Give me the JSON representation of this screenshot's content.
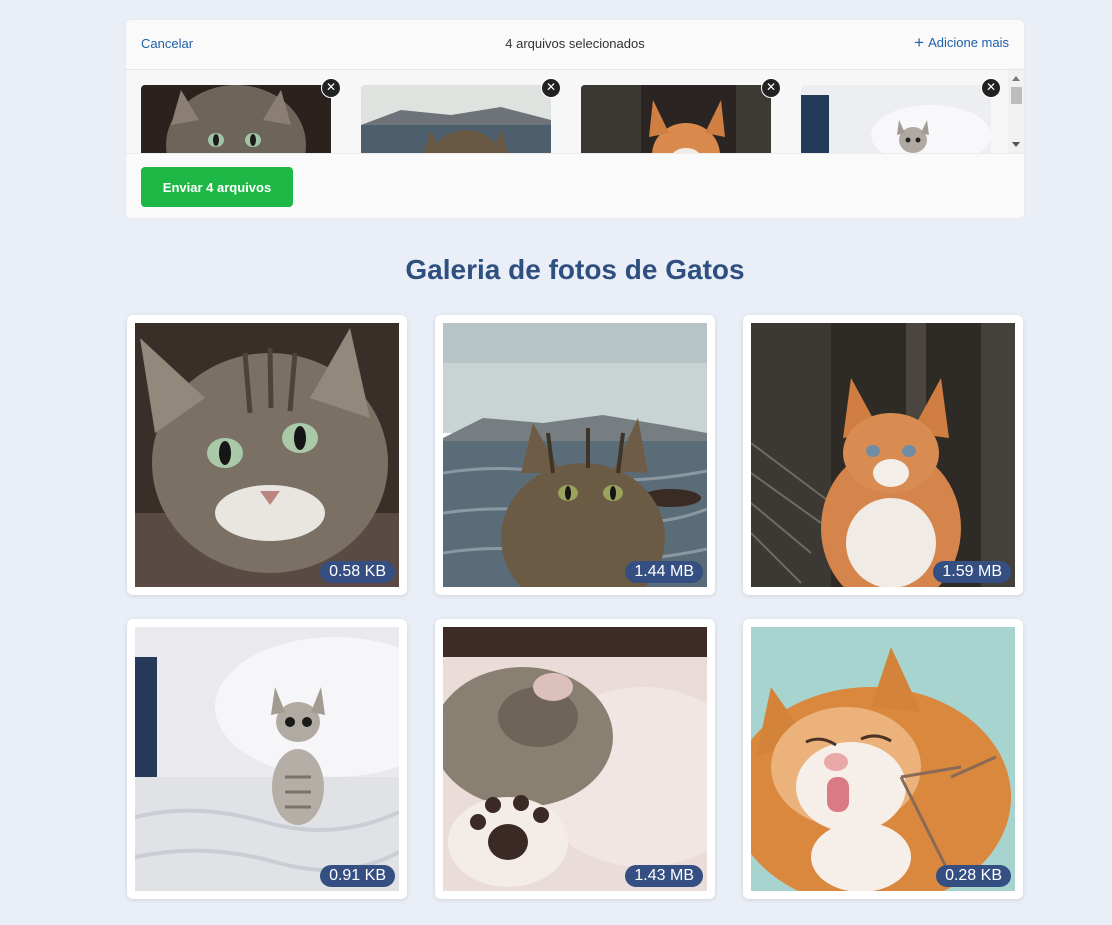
{
  "uploader": {
    "cancel_label": "Cancelar",
    "selected_count": "4 arquivos selecionados",
    "add_more_label": "Adicione mais",
    "send_label": "Enviar 4 arquivos",
    "remove_symbol": "✕",
    "thumbnails": [
      {
        "subject": "tabby-cat-closeup"
      },
      {
        "subject": "tabby-cat-by-sea"
      },
      {
        "subject": "orange-kitten"
      },
      {
        "subject": "grey-kitten-on-bed"
      }
    ]
  },
  "gallery": {
    "title": "Galeria de fotos de Gatos",
    "items": [
      {
        "size": "0.58 KB",
        "subject": "tabby-cat-closeup"
      },
      {
        "size": "1.44 MB",
        "subject": "tabby-cat-by-sea"
      },
      {
        "size": "1.59 MB",
        "subject": "orange-kitten"
      },
      {
        "size": "0.91 KB",
        "subject": "grey-kitten-on-bed"
      },
      {
        "size": "1.43 MB",
        "subject": "sleeping-cat-paw"
      },
      {
        "size": "0.28 KB",
        "subject": "orange-cat-licking"
      }
    ]
  },
  "colors": {
    "background": "#e9eef7",
    "accent_link": "#1f5fa8",
    "send_button": "#1eb847",
    "title": "#2f4f80",
    "badge": "#354f82"
  }
}
